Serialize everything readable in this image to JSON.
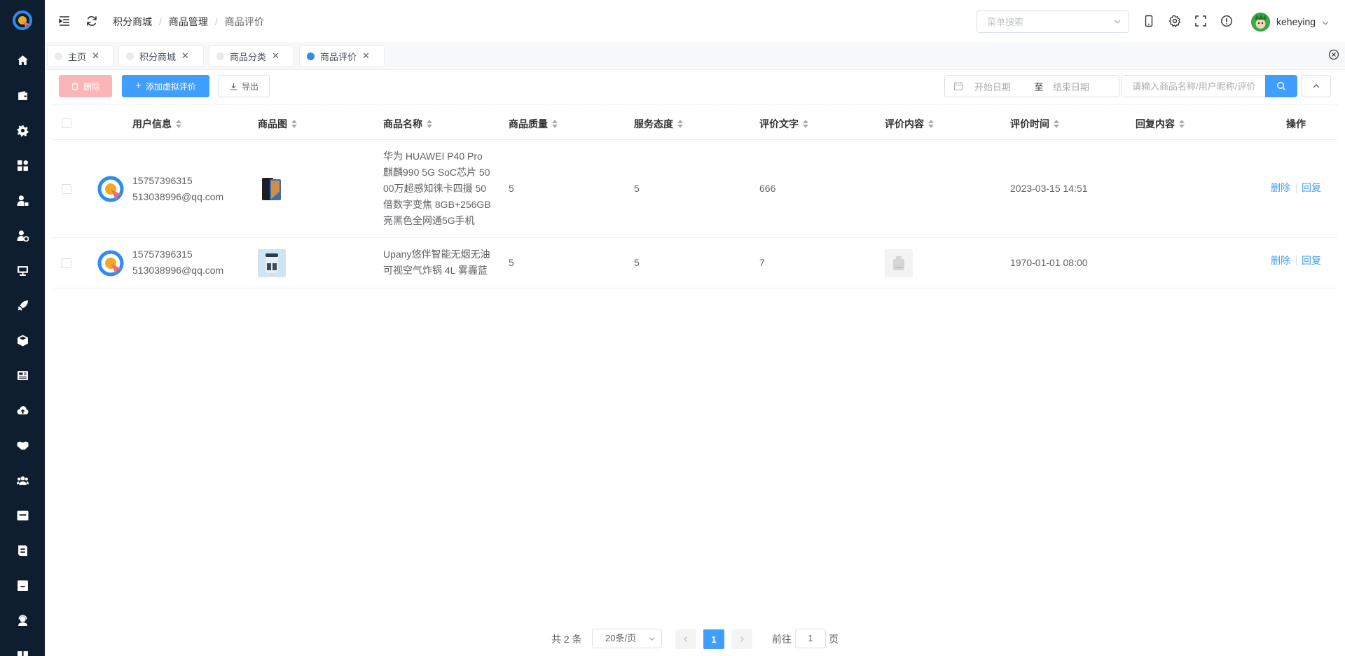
{
  "sidebar": {
    "logo": "app-logo",
    "items": [
      {
        "icon": "home-icon"
      },
      {
        "icon": "wallet-icon"
      },
      {
        "icon": "gear-icon"
      },
      {
        "icon": "grid-icon"
      },
      {
        "icon": "user-lock-icon"
      },
      {
        "icon": "user-settings-icon"
      },
      {
        "icon": "monitor-icon"
      },
      {
        "icon": "rocket-icon"
      },
      {
        "icon": "box-icon"
      },
      {
        "icon": "newspaper-icon"
      },
      {
        "icon": "cloud-upload-icon"
      },
      {
        "icon": "handshake-icon"
      },
      {
        "icon": "users-icon"
      },
      {
        "icon": "ticket-icon"
      },
      {
        "icon": "store-icon"
      },
      {
        "icon": "message-icon"
      },
      {
        "icon": "support-icon"
      },
      {
        "icon": "book-icon"
      }
    ]
  },
  "header": {
    "breadcrumb": [
      "积分商城",
      "商品管理",
      "商品评价"
    ],
    "menu_search_placeholder": "菜单搜索",
    "username": "keheying"
  },
  "tabs": [
    {
      "label": "主页",
      "active": false
    },
    {
      "label": "积分商城",
      "active": false
    },
    {
      "label": "商品分类",
      "active": false
    },
    {
      "label": "商品评价",
      "active": true
    }
  ],
  "toolbar": {
    "delete_label": "删除",
    "add_virtual_label": "添加虚拟评价",
    "export_label": "导出",
    "start_date_placeholder": "开始日期",
    "range_separator": "至",
    "end_date_placeholder": "结束日期",
    "search_placeholder": "请输入商品名称/用户昵称/评价"
  },
  "table": {
    "columns": [
      "用户信息",
      "商品图",
      "商品名称",
      "商品质量",
      "服务态度",
      "评价文字",
      "评价内容",
      "评价时间",
      "回复内容",
      "操作"
    ],
    "rows": [
      {
        "phone": "15757396315",
        "email": "513038996@qq.com",
        "product_name_lines": [
          "华为 HUAWEI P40 Pro",
          "麒麟990 5G SoC芯片 50",
          "00万超感知徕卡四摄 50",
          "倍数字变焦 8GB+256GB",
          "亮黑色全网通5G手机"
        ],
        "quality": "5",
        "service": "5",
        "comment_text": "666",
        "time": "2023-03-15 14:51",
        "reply": "",
        "op_delete": "删除",
        "op_reply": "回复"
      },
      {
        "phone": "15757396315",
        "email": "513038996@qq.com",
        "product_name_lines": [
          "Upany悠伴智能无烟无油",
          "可视空气炸锅 4L 雾霾蓝"
        ],
        "quality": "5",
        "service": "5",
        "comment_text": "7",
        "time": "1970-01-01 08:00",
        "reply": "",
        "op_delete": "删除",
        "op_reply": "回复"
      }
    ]
  },
  "pagination": {
    "total_text": "共 2 条",
    "page_size": "20条/页",
    "current_page": "1",
    "goto_prefix": "前往",
    "goto_value": "1",
    "goto_suffix": "页"
  },
  "colors": {
    "sidebar_bg": "#0f1e2e",
    "primary": "#409eff",
    "danger_disabled": "#fab6b6"
  }
}
